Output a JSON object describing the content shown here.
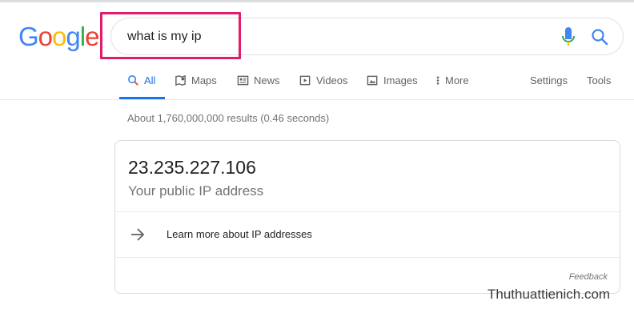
{
  "logo": {
    "letters": [
      "G",
      "o",
      "o",
      "g",
      "l",
      "e"
    ],
    "colors": [
      "#4285f4",
      "#ea4335",
      "#fbbc05",
      "#4285f4",
      "#34a853",
      "#ea4335"
    ]
  },
  "search": {
    "query": "what is my ip"
  },
  "tabs": [
    {
      "label": "All",
      "icon": "search-icon"
    },
    {
      "label": "Maps",
      "icon": "map-icon"
    },
    {
      "label": "News",
      "icon": "news-icon"
    },
    {
      "label": "Videos",
      "icon": "play-icon"
    },
    {
      "label": "Images",
      "icon": "image-icon"
    },
    {
      "label": "More",
      "icon": "more-vert-icon"
    },
    {
      "label": "Settings"
    },
    {
      "label": "Tools"
    }
  ],
  "stats": "About 1,760,000,000 results (0.46 seconds)",
  "answer": {
    "ip": "23.235.227.106",
    "subtitle": "Your public IP address",
    "learn_more": "Learn more about IP addresses",
    "feedback": "Feedback"
  },
  "watermark": "Thuthuattienich.com",
  "colors": {
    "accent": "#1a73e8",
    "highlight": "#e01c6c"
  }
}
